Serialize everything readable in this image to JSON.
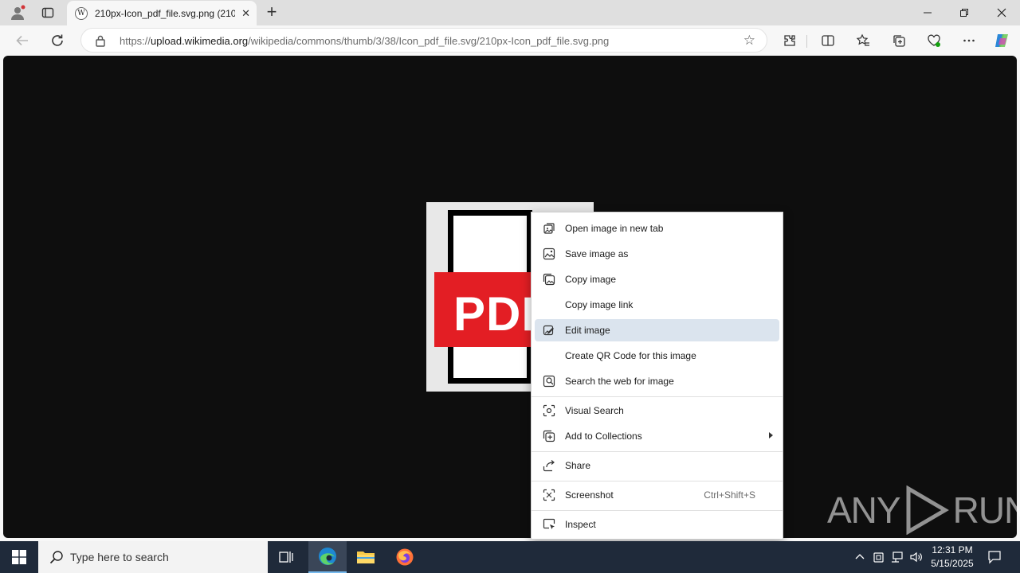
{
  "browser": {
    "tab_title": "210px-Icon_pdf_file.svg.png (210",
    "url_prefix": "https://",
    "url_host": "upload.wikimedia.org",
    "url_path": "/wikipedia/commons/thumb/3/38/Icon_pdf_file.svg/210px-Icon_pdf_file.svg.png",
    "favicon_glyph": "W"
  },
  "page": {
    "image_text": "PDF"
  },
  "context_menu": {
    "items": [
      {
        "label": "Open image in new tab",
        "icon": "open-new-tab-icon"
      },
      {
        "label": "Save image as",
        "icon": "save-image-icon"
      },
      {
        "label": "Copy image",
        "icon": "copy-image-icon"
      },
      {
        "label": "Copy image link",
        "icon": ""
      },
      {
        "label": "Edit image",
        "icon": "edit-image-icon",
        "highlighted": true
      },
      {
        "label": "Create QR Code for this image",
        "icon": ""
      },
      {
        "label": "Search the web for image",
        "icon": "search-web-image-icon"
      },
      {
        "label": "Visual Search",
        "icon": "visual-search-icon"
      },
      {
        "label": "Add to Collections",
        "icon": "collections-icon",
        "submenu": true
      },
      {
        "label": "Share",
        "icon": "share-icon"
      },
      {
        "label": "Screenshot",
        "icon": "screenshot-icon",
        "shortcut": "Ctrl+Shift+S"
      },
      {
        "label": "Inspect",
        "icon": "inspect-icon"
      }
    ]
  },
  "watermark": {
    "left": "ANY",
    "right": "RUN"
  },
  "taskbar": {
    "search_placeholder": "Type here to search",
    "time": "12:31 PM",
    "date": "5/15/2025"
  },
  "colors": {
    "pdf_red": "#e31e24",
    "highlight": "#dbe4ee",
    "taskbar": "#1f2a3a"
  }
}
